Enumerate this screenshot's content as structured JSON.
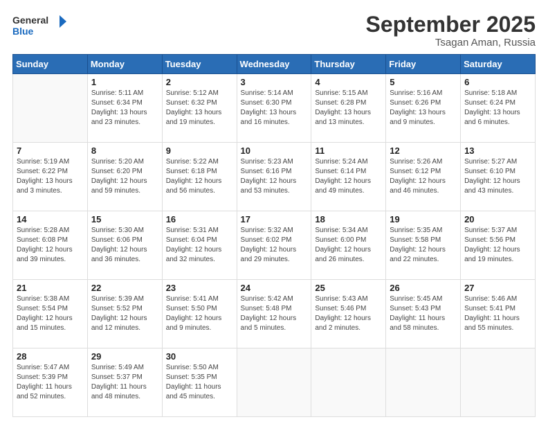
{
  "header": {
    "logo_general": "General",
    "logo_blue": "Blue",
    "month_title": "September 2025",
    "location": "Tsagan Aman, Russia"
  },
  "weekdays": [
    "Sunday",
    "Monday",
    "Tuesday",
    "Wednesday",
    "Thursday",
    "Friday",
    "Saturday"
  ],
  "weeks": [
    [
      {
        "day": "",
        "info": ""
      },
      {
        "day": "1",
        "info": "Sunrise: 5:11 AM\nSunset: 6:34 PM\nDaylight: 13 hours\nand 23 minutes."
      },
      {
        "day": "2",
        "info": "Sunrise: 5:12 AM\nSunset: 6:32 PM\nDaylight: 13 hours\nand 19 minutes."
      },
      {
        "day": "3",
        "info": "Sunrise: 5:14 AM\nSunset: 6:30 PM\nDaylight: 13 hours\nand 16 minutes."
      },
      {
        "day": "4",
        "info": "Sunrise: 5:15 AM\nSunset: 6:28 PM\nDaylight: 13 hours\nand 13 minutes."
      },
      {
        "day": "5",
        "info": "Sunrise: 5:16 AM\nSunset: 6:26 PM\nDaylight: 13 hours\nand 9 minutes."
      },
      {
        "day": "6",
        "info": "Sunrise: 5:18 AM\nSunset: 6:24 PM\nDaylight: 13 hours\nand 6 minutes."
      }
    ],
    [
      {
        "day": "7",
        "info": "Sunrise: 5:19 AM\nSunset: 6:22 PM\nDaylight: 13 hours\nand 3 minutes."
      },
      {
        "day": "8",
        "info": "Sunrise: 5:20 AM\nSunset: 6:20 PM\nDaylight: 12 hours\nand 59 minutes."
      },
      {
        "day": "9",
        "info": "Sunrise: 5:22 AM\nSunset: 6:18 PM\nDaylight: 12 hours\nand 56 minutes."
      },
      {
        "day": "10",
        "info": "Sunrise: 5:23 AM\nSunset: 6:16 PM\nDaylight: 12 hours\nand 53 minutes."
      },
      {
        "day": "11",
        "info": "Sunrise: 5:24 AM\nSunset: 6:14 PM\nDaylight: 12 hours\nand 49 minutes."
      },
      {
        "day": "12",
        "info": "Sunrise: 5:26 AM\nSunset: 6:12 PM\nDaylight: 12 hours\nand 46 minutes."
      },
      {
        "day": "13",
        "info": "Sunrise: 5:27 AM\nSunset: 6:10 PM\nDaylight: 12 hours\nand 43 minutes."
      }
    ],
    [
      {
        "day": "14",
        "info": "Sunrise: 5:28 AM\nSunset: 6:08 PM\nDaylight: 12 hours\nand 39 minutes."
      },
      {
        "day": "15",
        "info": "Sunrise: 5:30 AM\nSunset: 6:06 PM\nDaylight: 12 hours\nand 36 minutes."
      },
      {
        "day": "16",
        "info": "Sunrise: 5:31 AM\nSunset: 6:04 PM\nDaylight: 12 hours\nand 32 minutes."
      },
      {
        "day": "17",
        "info": "Sunrise: 5:32 AM\nSunset: 6:02 PM\nDaylight: 12 hours\nand 29 minutes."
      },
      {
        "day": "18",
        "info": "Sunrise: 5:34 AM\nSunset: 6:00 PM\nDaylight: 12 hours\nand 26 minutes."
      },
      {
        "day": "19",
        "info": "Sunrise: 5:35 AM\nSunset: 5:58 PM\nDaylight: 12 hours\nand 22 minutes."
      },
      {
        "day": "20",
        "info": "Sunrise: 5:37 AM\nSunset: 5:56 PM\nDaylight: 12 hours\nand 19 minutes."
      }
    ],
    [
      {
        "day": "21",
        "info": "Sunrise: 5:38 AM\nSunset: 5:54 PM\nDaylight: 12 hours\nand 15 minutes."
      },
      {
        "day": "22",
        "info": "Sunrise: 5:39 AM\nSunset: 5:52 PM\nDaylight: 12 hours\nand 12 minutes."
      },
      {
        "day": "23",
        "info": "Sunrise: 5:41 AM\nSunset: 5:50 PM\nDaylight: 12 hours\nand 9 minutes."
      },
      {
        "day": "24",
        "info": "Sunrise: 5:42 AM\nSunset: 5:48 PM\nDaylight: 12 hours\nand 5 minutes."
      },
      {
        "day": "25",
        "info": "Sunrise: 5:43 AM\nSunset: 5:46 PM\nDaylight: 12 hours\nand 2 minutes."
      },
      {
        "day": "26",
        "info": "Sunrise: 5:45 AM\nSunset: 5:43 PM\nDaylight: 11 hours\nand 58 minutes."
      },
      {
        "day": "27",
        "info": "Sunrise: 5:46 AM\nSunset: 5:41 PM\nDaylight: 11 hours\nand 55 minutes."
      }
    ],
    [
      {
        "day": "28",
        "info": "Sunrise: 5:47 AM\nSunset: 5:39 PM\nDaylight: 11 hours\nand 52 minutes."
      },
      {
        "day": "29",
        "info": "Sunrise: 5:49 AM\nSunset: 5:37 PM\nDaylight: 11 hours\nand 48 minutes."
      },
      {
        "day": "30",
        "info": "Sunrise: 5:50 AM\nSunset: 5:35 PM\nDaylight: 11 hours\nand 45 minutes."
      },
      {
        "day": "",
        "info": ""
      },
      {
        "day": "",
        "info": ""
      },
      {
        "day": "",
        "info": ""
      },
      {
        "day": "",
        "info": ""
      }
    ]
  ]
}
